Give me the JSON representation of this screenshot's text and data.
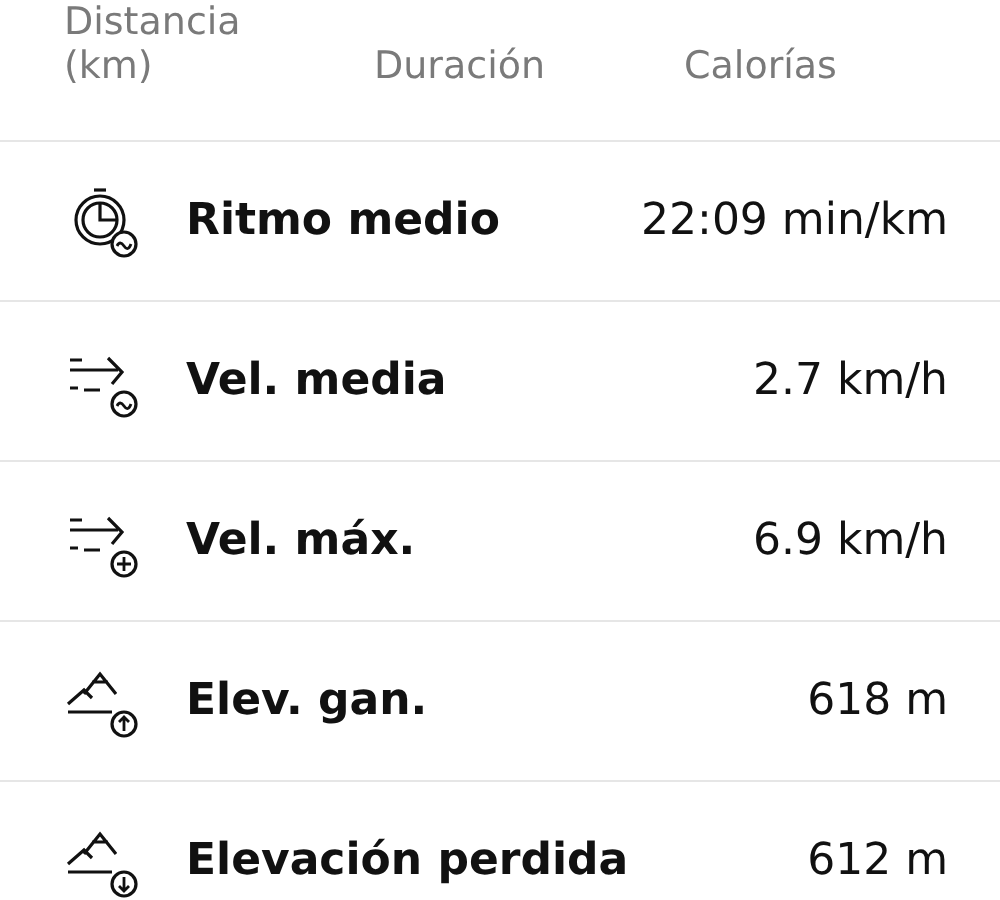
{
  "summary_labels": [
    {
      "lines": [
        "Distancia",
        "(km)"
      ]
    },
    {
      "lines": [
        "Duración"
      ]
    },
    {
      "lines": [
        "Calorías"
      ]
    }
  ],
  "metrics": [
    {
      "kind": "pace",
      "label": "Ritmo medio",
      "value": "22:09 min/km"
    },
    {
      "kind": "avg-speed",
      "label": "Vel. media",
      "value": "2.7 km/h"
    },
    {
      "kind": "max-speed",
      "label": "Vel. máx.",
      "value": "6.9 km/h"
    },
    {
      "kind": "elev-gain",
      "label": "Elev. gan.",
      "value": "618 m"
    },
    {
      "kind": "elev-loss",
      "label": "Elevación perdida",
      "value": "612 m"
    }
  ]
}
